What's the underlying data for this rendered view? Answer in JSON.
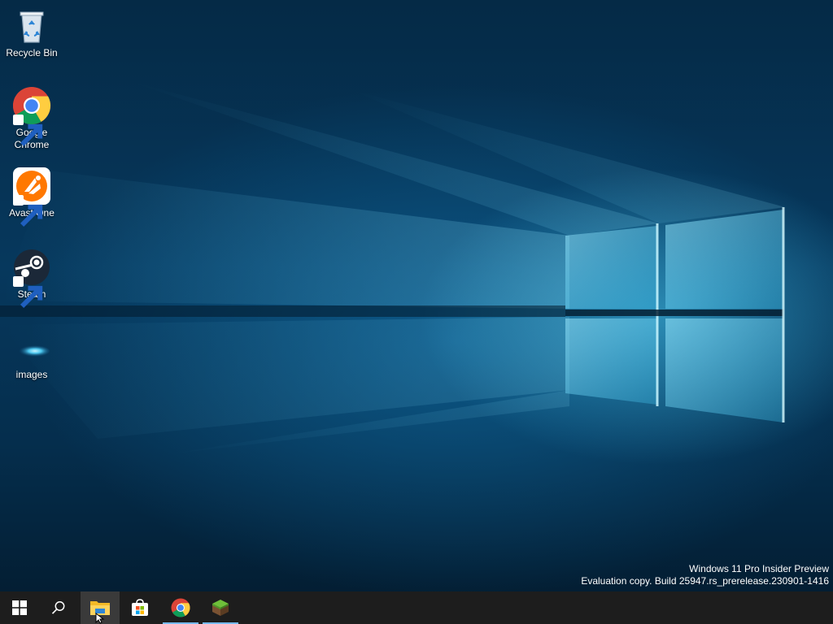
{
  "desktop": {
    "icons": [
      {
        "label": "Recycle Bin",
        "icon": "recycle-bin-icon"
      },
      {
        "label": "Google Chrome",
        "icon": "chrome-icon"
      },
      {
        "label": "Avast One",
        "icon": "avast-icon"
      },
      {
        "label": "Steam",
        "icon": "steam-icon"
      },
      {
        "label": "images",
        "icon": "folder-icon"
      }
    ],
    "watermark": {
      "line1": "Windows 11 Pro Insider Preview",
      "line2": "Evaluation copy. Build 25947.rs_prerelease.230901-1416"
    }
  },
  "taskbar": {
    "buttons": [
      {
        "name": "Start",
        "icon": "windows-logo-icon"
      },
      {
        "name": "Search",
        "icon": "search-icon"
      },
      {
        "name": "File Explorer",
        "icon": "file-explorer-icon",
        "active": true
      },
      {
        "name": "Microsoft Store",
        "icon": "store-icon"
      },
      {
        "name": "Google Chrome",
        "icon": "chrome-icon",
        "running": true
      },
      {
        "name": "Minecraft",
        "icon": "minecraft-icon",
        "running": true
      }
    ],
    "colors": {
      "background": "#1d1d1d",
      "running_indicator": "#76b9ed",
      "active_bg": "#3a3a3a"
    }
  }
}
